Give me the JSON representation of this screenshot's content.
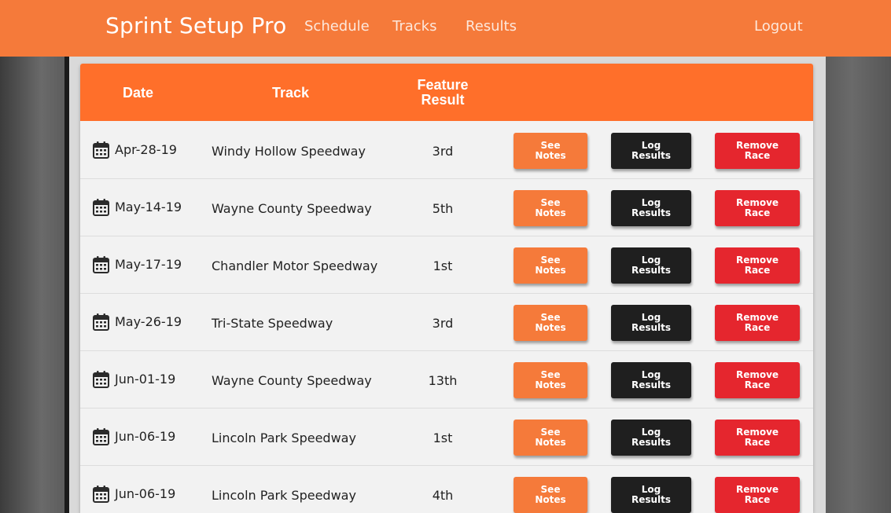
{
  "nav": {
    "brand": "Sprint Setup Pro",
    "links": [
      "Schedule",
      "Tracks",
      "Results"
    ],
    "logout": "Logout"
  },
  "table": {
    "headers": {
      "date": "Date",
      "track": "Track",
      "feature_line1": "Feature",
      "feature_line2": "Result"
    },
    "buttons": {
      "notes_line1": "See",
      "notes_line2": "Notes",
      "log_line1": "Log",
      "log_line2": "Results",
      "remove_line1": "Remove",
      "remove_line2": "Race"
    },
    "rows": [
      {
        "date": "Apr-28-19",
        "track": "Windy Hollow Speedway",
        "result": "3rd"
      },
      {
        "date": "May-14-19",
        "track": "Wayne County Speedway",
        "result": "5th"
      },
      {
        "date": "May-17-19",
        "track": "Chandler Motor Speedway",
        "result": "1st"
      },
      {
        "date": "May-26-19",
        "track": "Tri-State Speedway",
        "result": "3rd"
      },
      {
        "date": "Jun-01-19",
        "track": "Wayne County Speedway",
        "result": "13th"
      },
      {
        "date": "Jun-06-19",
        "track": "Lincoln Park Speedway",
        "result": "1st"
      },
      {
        "date": "Jun-06-19",
        "track": "Lincoln Park Speedway",
        "result": "4th"
      }
    ]
  },
  "colors": {
    "brand_orange": "#f57a3a",
    "header_orange": "#ff6f2a",
    "log_black": "#1f1f1f",
    "remove_red": "#e5262e"
  }
}
